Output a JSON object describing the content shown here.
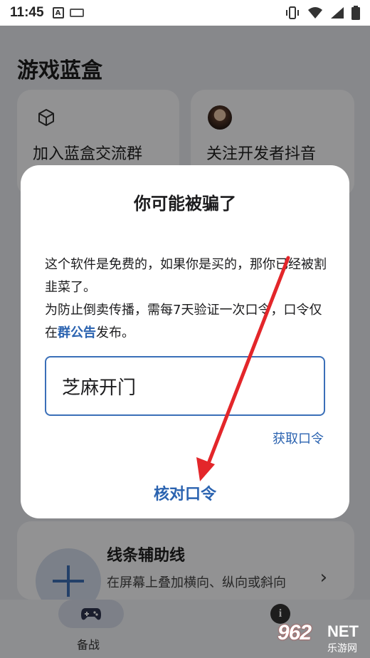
{
  "status_bar": {
    "time": "11:45",
    "a_badge": "A",
    "icons": [
      "vibrate-icon",
      "wifi-icon",
      "signal-icon",
      "battery-icon"
    ]
  },
  "app": {
    "title": "游戏蓝盒",
    "cards": [
      {
        "title": "加入蓝盒交流群",
        "icon": "cube-icon"
      },
      {
        "title": "关注开发者抖音",
        "icon": "avatar"
      }
    ],
    "line_card": {
      "title": "线条辅助线",
      "description": "在屏幕上叠加横向、纵向或斜向"
    },
    "bottom_nav": {
      "active_label": "备战"
    }
  },
  "dialog": {
    "title": "你可能被骗了",
    "line1": "这个软件是免费的，如果你是买的，那你已经被割韭菜了。",
    "line2_prefix": "为防止倒卖传播，需每7天验证一次口令，口令仅在",
    "line2_link": "群公告",
    "line2_suffix": "发布。",
    "input_value": "芝麻开门",
    "get_code_label": "获取口令",
    "verify_label": "核对口令"
  },
  "watermark": {
    "number": "962",
    "net": "NET",
    "site": "乐游网"
  },
  "colors": {
    "accent": "#2b63b0",
    "arrow": "#e3262a",
    "scrim": "rgba(0,0,0,0.42)"
  }
}
